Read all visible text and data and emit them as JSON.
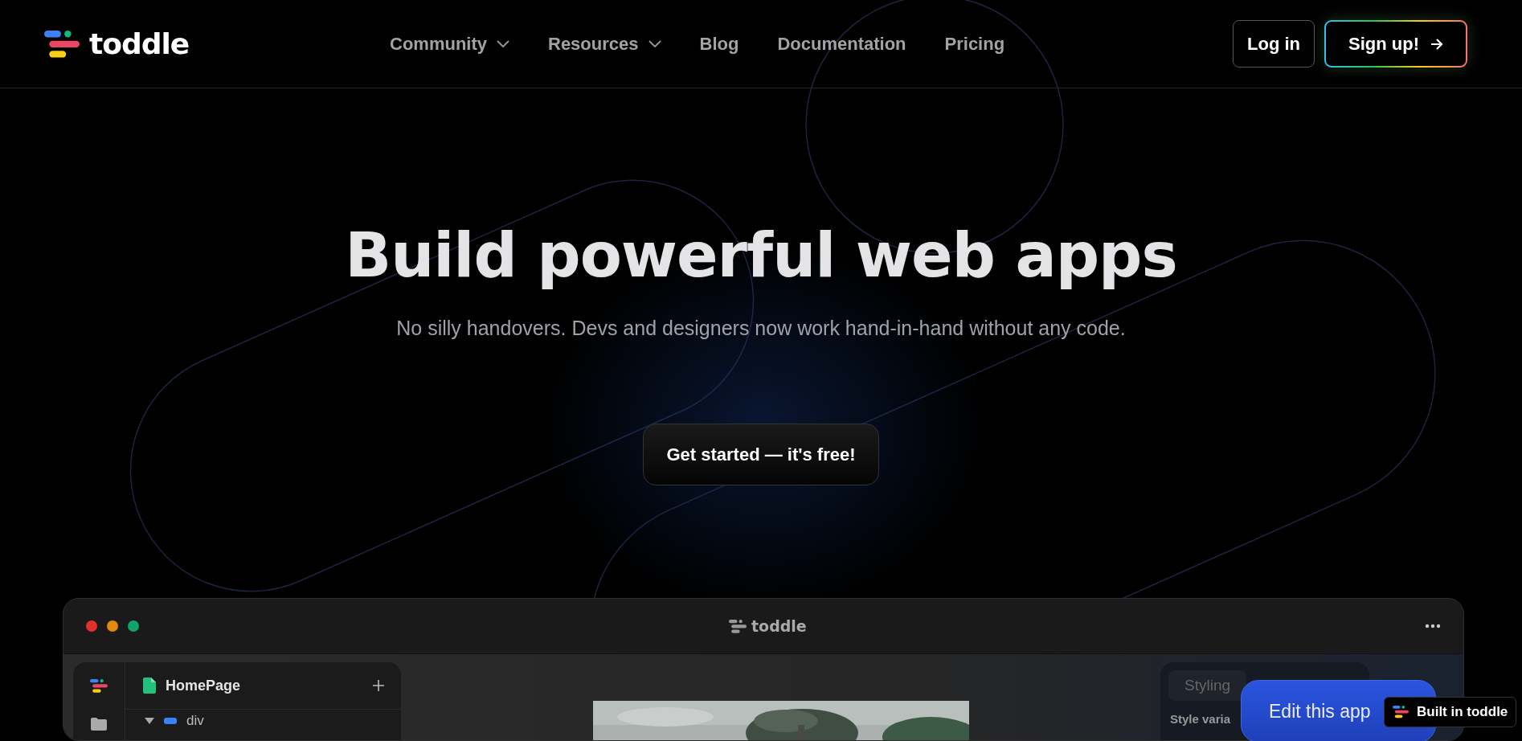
{
  "header": {
    "logo": "toddle",
    "nav": [
      {
        "label": "Community",
        "dropdown": true
      },
      {
        "label": "Resources",
        "dropdown": true
      },
      {
        "label": "Blog",
        "dropdown": false
      },
      {
        "label": "Documentation",
        "dropdown": false
      },
      {
        "label": "Pricing",
        "dropdown": false
      }
    ],
    "login": "Log in",
    "signup": "Sign up!"
  },
  "hero": {
    "title": "Build powerful web apps",
    "subtitle": "No silly handovers. Devs and designers now work hand-in-hand without any code.",
    "cta": "Get started — it's free!"
  },
  "app_window": {
    "title": "toddle",
    "page": "HomePage",
    "tree_item": "div",
    "panel_tab": "Styling",
    "panel_label": "Style varia"
  },
  "edit_button": "Edit this app",
  "badge": "Built in toddle"
}
